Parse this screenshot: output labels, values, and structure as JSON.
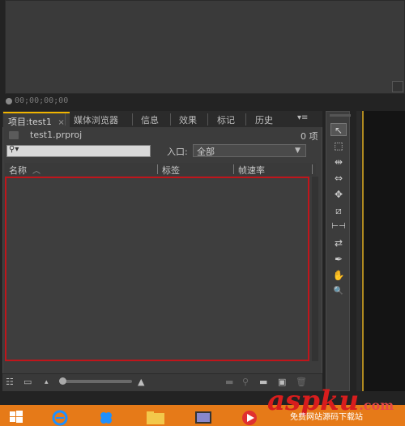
{
  "monitor": {
    "timecode": "00;00;00;00"
  },
  "project_panel": {
    "tabs": [
      {
        "label": "项目:test1",
        "close": "×",
        "active": true
      },
      {
        "label": "媒体浏览器"
      },
      {
        "label": "信息"
      },
      {
        "label": "效果"
      },
      {
        "label": "标记"
      },
      {
        "label": "历史"
      }
    ],
    "menu_glyph": "▾≡",
    "project_file": "test1.prproj",
    "item_count": "0 项",
    "search_icon_glyph": "⚲▾",
    "inpoint_label": "入口:",
    "inpoint_value": "全部",
    "inpoint_arrow": "▼",
    "columns": [
      "名称",
      "标签",
      "帧速率"
    ],
    "name_sort_glyph": "︿"
  },
  "bottom_bar": {
    "list_view_glyph": "☷",
    "icon_view_glyph": "▭",
    "zoom_small_glyph": "▴",
    "zoom_large_glyph": "▲",
    "new_bin_glyph": "▬",
    "new_item_glyph": "▣",
    "find_glyph": "⚲",
    "clear_glyph": "🗑"
  },
  "tools": {
    "glyphs": [
      "↖",
      "⬚",
      "⇹",
      "⇔",
      "✥",
      "⧄",
      "⊢⊣",
      "⇄",
      "✒",
      "✋",
      "🔍"
    ]
  },
  "watermark": {
    "brand": "aspku",
    "suffix": ".com",
    "caption": "免费网站源码下载站"
  },
  "colors": {
    "highlight_border": "#c0151b",
    "active_tab": "#f0b400",
    "taskbar": "#e67a18"
  }
}
